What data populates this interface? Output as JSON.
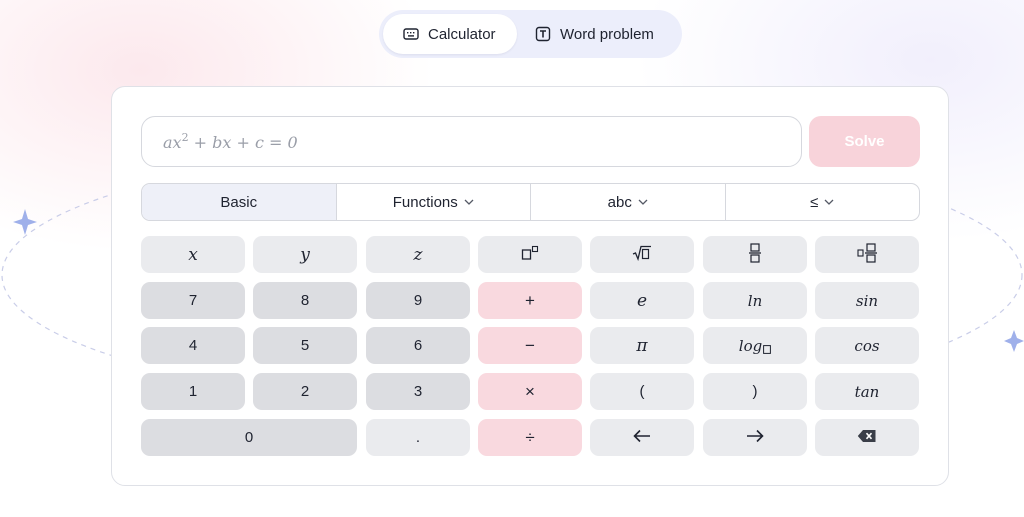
{
  "mode_tabs": [
    {
      "label": "Calculator",
      "icon": "keyboard-icon",
      "active": true
    },
    {
      "label": "Word problem",
      "icon": "text-t-icon",
      "active": false
    }
  ],
  "equation_input": {
    "placeholder": "ax² + bx + c = 0",
    "placeholder_parts": {
      "a": "ax",
      "exp": "2",
      "rest": " + bx + c = 0"
    }
  },
  "solve_button": {
    "label": "Solve"
  },
  "keypad_tabs": [
    {
      "label": "Basic",
      "dropdown": false,
      "active": true
    },
    {
      "label": "Functions",
      "dropdown": true,
      "active": false
    },
    {
      "label": "abc",
      "dropdown": true,
      "active": false
    },
    {
      "label": "≤",
      "dropdown": true,
      "active": false
    }
  ],
  "keys": {
    "x": "x",
    "y": "y",
    "z": "z",
    "superscript": "superscript-icon",
    "sqrt": "square-root-icon",
    "fraction": "fraction-icon",
    "mixed_fraction": "mixed-fraction-icon",
    "n7": "7",
    "n8": "8",
    "n9": "9",
    "plus": "+",
    "e": "e",
    "ln": "ln",
    "sin": "sin",
    "n4": "4",
    "n5": "5",
    "n6": "6",
    "minus": "−",
    "pi": "π",
    "log": "log",
    "cos": "cos",
    "n1": "1",
    "n2": "2",
    "n3": "3",
    "times": "×",
    "lparen": "(",
    "rparen": ")",
    "tan": "tan",
    "n0": "0",
    "dot": ".",
    "divide": "÷",
    "left": "arrow-left-icon",
    "right": "arrow-right-icon",
    "backspace": "backspace-icon"
  },
  "colors": {
    "accent_pink": "#f8d3da",
    "operator_key": "#f9d9df",
    "number_key": "#dcdde1",
    "function_key": "#eaebee",
    "toggle_bg": "#eceefb",
    "star": "#9fb0ea"
  }
}
